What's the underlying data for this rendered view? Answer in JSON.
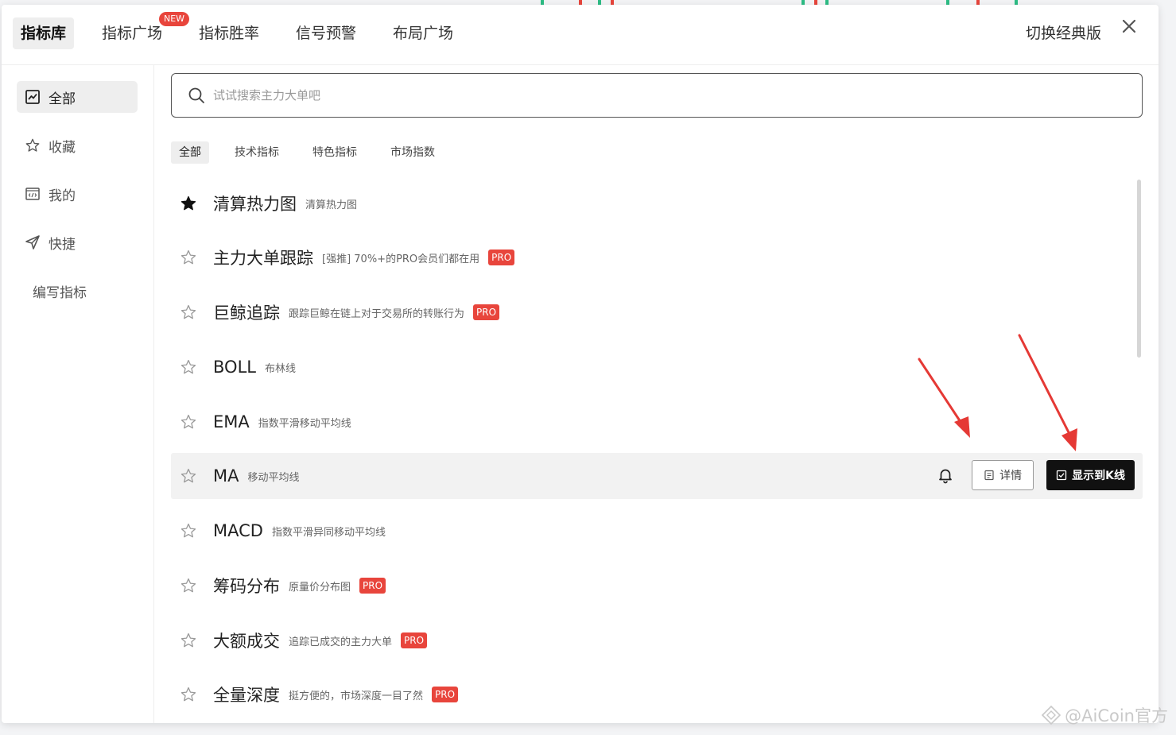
{
  "top_tabs": [
    {
      "label": "指标库",
      "active": true
    },
    {
      "label": "指标广场",
      "active": false
    },
    {
      "label": "指标胜率",
      "active": false
    },
    {
      "label": "信号预警",
      "active": false
    },
    {
      "label": "布局广场",
      "active": false
    }
  ],
  "new_badge": "NEW",
  "switch_classic": "切换经典版",
  "sidebar": {
    "items": [
      {
        "label": "全部",
        "icon": "chart-box-icon",
        "active": true
      },
      {
        "label": "收藏",
        "icon": "star-outline-icon",
        "active": false
      },
      {
        "label": "我的",
        "icon": "code-box-icon",
        "active": false
      },
      {
        "label": "快捷",
        "icon": "send-icon",
        "active": false
      }
    ],
    "write_indicator": "编写指标"
  },
  "search": {
    "placeholder": "试试搜索主力大单吧"
  },
  "filter_tabs": [
    {
      "label": "全部",
      "active": true
    },
    {
      "label": "技术指标",
      "active": false
    },
    {
      "label": "特色指标",
      "active": false
    },
    {
      "label": "市场指数",
      "active": false
    }
  ],
  "indicators": [
    {
      "name": "清算热力图",
      "desc": "清算热力图",
      "pro": false,
      "favorited": true
    },
    {
      "name": "主力大单跟踪",
      "desc": "[强推] 70%+的PRO会员们都在用",
      "pro": true,
      "favorited": false
    },
    {
      "name": "巨鲸追踪",
      "desc": "跟踪巨鲸在链上对于交易所的转账行为",
      "pro": true,
      "favorited": false
    },
    {
      "name": "BOLL",
      "desc": "布林线",
      "pro": false,
      "favorited": false
    },
    {
      "name": "EMA",
      "desc": "指数平滑移动平均线",
      "pro": false,
      "favorited": false
    },
    {
      "name": "MA",
      "desc": "移动平均线",
      "pro": false,
      "favorited": false,
      "hovered": true
    },
    {
      "name": "MACD",
      "desc": "指数平滑异同移动平均线",
      "pro": false,
      "favorited": false
    },
    {
      "name": "筹码分布",
      "desc": "原量价分布图",
      "pro": true,
      "favorited": false
    },
    {
      "name": "大额成交",
      "desc": "追踪已成交的主力大单",
      "pro": true,
      "favorited": false
    },
    {
      "name": "全量深度",
      "desc": "挺方便的，市场深度一目了然",
      "pro": true,
      "favorited": false
    }
  ],
  "pro_label": "PRO",
  "row_actions": {
    "detail": "详情",
    "show_on_chart": "显示到K线"
  },
  "watermark": "@AiCoin官方",
  "colors": {
    "accent_red": "#e8453c",
    "primary_dark": "#111111",
    "annotation_arrow": "#e53935"
  }
}
